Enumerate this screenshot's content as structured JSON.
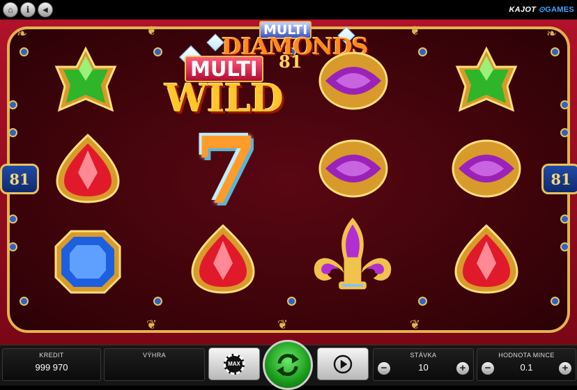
{
  "top_bar": {
    "buttons": [
      {
        "icon": "home-icon",
        "glyph": "⌂"
      },
      {
        "icon": "info-icon",
        "glyph": "i"
      },
      {
        "icon": "sound-icon",
        "glyph": "◀"
      }
    ],
    "brand_left": "KAJOT",
    "brand_right": "GAMES"
  },
  "game": {
    "logo_main_multi": "MULTI",
    "logo_main_title": "DIAMONDS",
    "logo_main_number": "81",
    "logo_wild_multi": "MULTI",
    "logo_wild_title": "WILD",
    "lines_left": "81",
    "lines_right": "81",
    "seven_symbol": "7",
    "reels": [
      [
        "green-gem",
        "red-gem",
        "blue-gem"
      ],
      [
        "multi-wild",
        "seven",
        "red-gem"
      ],
      [
        "purple-gem",
        "purple-gem",
        "fleur-de-lis"
      ],
      [
        "green-gem",
        "purple-gem",
        "red-gem"
      ]
    ]
  },
  "controls": {
    "kredit_label": "KREDIT",
    "kredit_value": "999 970",
    "vyhra_label": "VÝHRA",
    "vyhra_value": "",
    "max_label": "MAX",
    "stavka_label": "STÁVKA",
    "stavka_value": "10",
    "coin_label": "HODNOTA MINCE",
    "coin_value": "0.1",
    "minus": "−",
    "plus": "+"
  },
  "colors": {
    "frame_red": "#9e0f24",
    "gold": "#e2b34c",
    "green_gem": "#2fb52a",
    "red_gem": "#e11a2b",
    "blue_gem": "#1e5fe0",
    "purple_gem": "#9b22b8",
    "spin_green": "#1a9a1a"
  }
}
